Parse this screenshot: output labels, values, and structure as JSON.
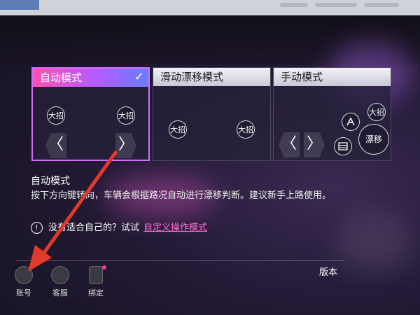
{
  "modes": [
    {
      "title": "自动模式",
      "selected": true
    },
    {
      "title": "滑动漂移模式",
      "selected": false
    },
    {
      "title": "手动模式",
      "selected": false
    }
  ],
  "controls": {
    "ult": "大招",
    "drift": "漂移",
    "left_arrow": "〈",
    "right_arrow": "〉",
    "check": "✓"
  },
  "description": {
    "title": "自动模式",
    "body": "按下方向键转向，车辆会根据路况自动进行漂移判断。建议新手上路使用。"
  },
  "hint": {
    "icon": "!",
    "text": "没有适合自己的？试试",
    "link": "自定义操作模式"
  },
  "footer": {
    "account": "账号",
    "service": "客服",
    "bind": "绑定",
    "version_label": "版本"
  },
  "colors": {
    "accent_pink": "#ff4fb3",
    "accent_purple": "#b35cff",
    "link": "#ff6fd0",
    "annotation_red": "#e33a2c"
  }
}
